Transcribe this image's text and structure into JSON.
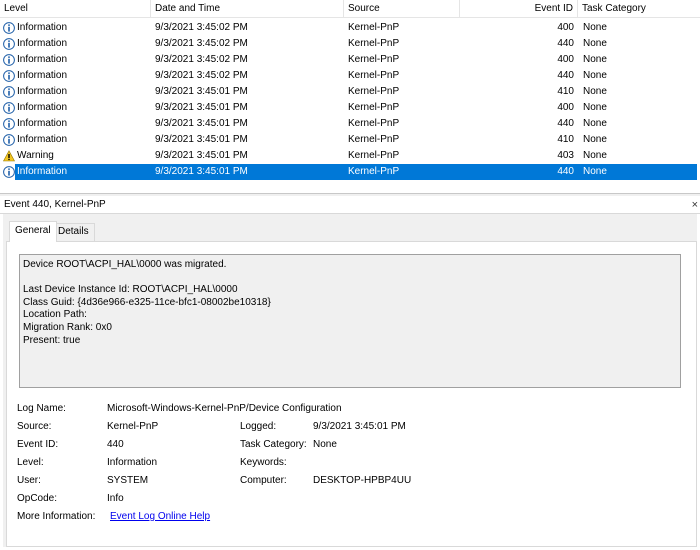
{
  "columns": {
    "level": "Level",
    "date": "Date and Time",
    "source": "Source",
    "event_id": "Event ID",
    "task": "Task Category"
  },
  "rows": [
    {
      "level": "Information",
      "icon": "info-icon",
      "date": "9/3/2021 3:45:02 PM",
      "source": "Kernel-PnP",
      "event_id": "400",
      "task": "None"
    },
    {
      "level": "Information",
      "icon": "info-icon",
      "date": "9/3/2021 3:45:02 PM",
      "source": "Kernel-PnP",
      "event_id": "440",
      "task": "None"
    },
    {
      "level": "Information",
      "icon": "info-icon",
      "date": "9/3/2021 3:45:02 PM",
      "source": "Kernel-PnP",
      "event_id": "400",
      "task": "None"
    },
    {
      "level": "Information",
      "icon": "info-icon",
      "date": "9/3/2021 3:45:02 PM",
      "source": "Kernel-PnP",
      "event_id": "440",
      "task": "None"
    },
    {
      "level": "Information",
      "icon": "info-icon",
      "date": "9/3/2021 3:45:01 PM",
      "source": "Kernel-PnP",
      "event_id": "410",
      "task": "None"
    },
    {
      "level": "Information",
      "icon": "info-icon",
      "date": "9/3/2021 3:45:01 PM",
      "source": "Kernel-PnP",
      "event_id": "400",
      "task": "None"
    },
    {
      "level": "Information",
      "icon": "info-icon",
      "date": "9/3/2021 3:45:01 PM",
      "source": "Kernel-PnP",
      "event_id": "440",
      "task": "None"
    },
    {
      "level": "Information",
      "icon": "info-icon",
      "date": "9/3/2021 3:45:01 PM",
      "source": "Kernel-PnP",
      "event_id": "410",
      "task": "None"
    },
    {
      "level": "Warning",
      "icon": "warning-icon",
      "date": "9/3/2021 3:45:01 PM",
      "source": "Kernel-PnP",
      "event_id": "403",
      "task": "None"
    },
    {
      "level": "Information",
      "icon": "info-icon",
      "date": "9/3/2021 3:45:01 PM",
      "source": "Kernel-PnP",
      "event_id": "440",
      "task": "None",
      "selected": true
    }
  ],
  "detail": {
    "title": "Event 440, Kernel-PnP",
    "close_glyph": "×",
    "tabs": [
      "General",
      "Details"
    ],
    "message": "Device ROOT\\ACPI_HAL\\0000 was migrated.\n\nLast Device Instance Id: ROOT\\ACPI_HAL\\0000\nClass Guid: {4d36e966-e325-11ce-bfc1-08002be10318}\nLocation Path:\nMigration Rank: 0x0\nPresent: true",
    "props": {
      "log_name_label": "Log Name:",
      "log_name": "Microsoft-Windows-Kernel-PnP/Device Configuration",
      "source_label": "Source:",
      "source": "Kernel-PnP",
      "logged_label": "Logged:",
      "logged": "9/3/2021 3:45:01 PM",
      "event_id_label": "Event ID:",
      "event_id": "440",
      "task_label": "Task Category:",
      "task": "None",
      "level_label": "Level:",
      "level": "Information",
      "keywords_label": "Keywords:",
      "keywords": "",
      "user_label": "User:",
      "user": "SYSTEM",
      "computer_label": "Computer:",
      "computer": "DESKTOP-HPBP4UU",
      "opcode_label": "OpCode:",
      "opcode": "Info",
      "more_info_label": "More Information:",
      "more_info_link": "Event Log Online Help"
    }
  },
  "colors": {
    "selection": "#0078d7",
    "info_icon": "#1f5fa8",
    "warning_icon": "#f3c623",
    "link": "#0000ee"
  }
}
